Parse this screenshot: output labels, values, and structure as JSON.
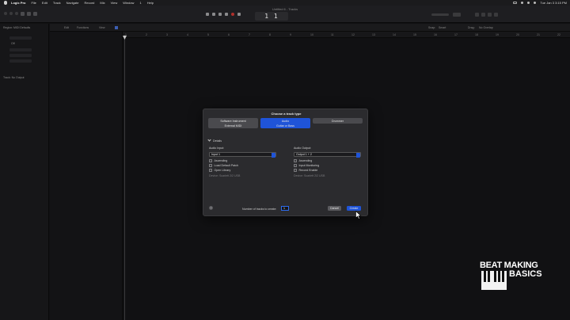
{
  "menubar": {
    "app_name": "Logic Pro",
    "items": [
      "File",
      "Edit",
      "Track",
      "Navigate",
      "Record",
      "Mix",
      "View",
      "Window",
      "1",
      "Help"
    ],
    "clock": "Tue Jan 3  3:15 PM"
  },
  "window": {
    "document_title": "Untitled 6 - Tracks",
    "lcd_value": "1 1",
    "inspector": {
      "region_label": "Region: MIDI Defaults",
      "track_label": "Track: No Output",
      "quantize_value": "Off"
    },
    "tracks_header": {
      "edit_label": "Edit",
      "functions_label": "Functions",
      "view_label": "View",
      "snap_label": "Snap:",
      "snap_value": "Smart",
      "drag_label": "Drag:",
      "drag_value": "No Overlap"
    },
    "ruler_marks": [
      "1",
      "2",
      "3",
      "4",
      "5",
      "6",
      "7",
      "8",
      "9",
      "10",
      "11",
      "12",
      "13",
      "14",
      "15",
      "16",
      "17",
      "18",
      "19",
      "20",
      "21",
      "22",
      "23"
    ]
  },
  "dialog": {
    "title": "Choose a track type",
    "track_types": [
      {
        "label": "Software Instrument",
        "sublabel": "External MIDI",
        "selected": false
      },
      {
        "label": "Audio",
        "sublabel": "Guitar or Bass",
        "selected": true
      }
    ],
    "drummer_label": "Drummer",
    "details_label": "Details",
    "audio_input": {
      "label": "Audio Input:",
      "value": "Input 1",
      "options": [
        "Ascending",
        "Load Default Patch",
        "Open Library"
      ],
      "device_note": "Device: Scarlett 2i2 USB"
    },
    "audio_output": {
      "label": "Audio Output:",
      "value": "Output 1 + 2",
      "options": [
        "Ascending",
        "Input Monitoring",
        "Record Enable"
      ],
      "device_note": "Device: Scarlett 2i2 USB"
    },
    "help_label": "?",
    "num_tracks_label": "Number of tracks to create:",
    "num_tracks_value": "1",
    "cancel_label": "Cancel",
    "create_label": "Create"
  },
  "watermark": {
    "line1": "BEAT MAKING",
    "line2": "BASICS"
  },
  "colors": {
    "accent": "#1f54d8",
    "dialog_bg": "#2b2b2e",
    "app_bg": "#111113"
  }
}
